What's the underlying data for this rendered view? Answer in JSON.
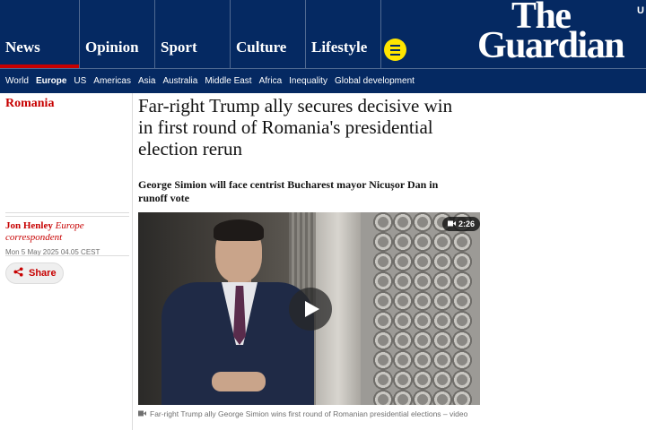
{
  "brand": {
    "line1": "The",
    "line2": "Guardian",
    "edition_partial": "U"
  },
  "pillars": [
    {
      "label": "News",
      "active": true
    },
    {
      "label": "Opinion",
      "active": false
    },
    {
      "label": "Sport",
      "active": false
    },
    {
      "label": "Culture",
      "active": false
    },
    {
      "label": "Lifestyle",
      "active": false
    }
  ],
  "menu_icon": "menu-icon",
  "subnav": [
    {
      "label": "World",
      "current": false
    },
    {
      "label": "Europe",
      "current": true
    },
    {
      "label": "US",
      "current": false
    },
    {
      "label": "Americas",
      "current": false
    },
    {
      "label": "Asia",
      "current": false
    },
    {
      "label": "Australia",
      "current": false
    },
    {
      "label": "Middle East",
      "current": false
    },
    {
      "label": "Africa",
      "current": false
    },
    {
      "label": "Inequality",
      "current": false
    },
    {
      "label": "Global development",
      "current": false
    }
  ],
  "article": {
    "section": "Romania",
    "headline": "Far-right Trump ally secures decisive win in first round of Romania's presidential election rerun",
    "standfirst": "George Simion will face centrist Bucharest mayor Nicușor Dan in runoff vote",
    "author_name": "Jon Henley",
    "author_role": "Europe correspondent",
    "date": "Mon 5 May 2025 04.05 CEST",
    "share_label": "Share"
  },
  "media": {
    "duration": "2:26",
    "caption": "Far-right Trump ally George Simion wins first round of Romanian presidential elections – video"
  },
  "colors": {
    "brand_blue": "#052962",
    "news_red": "#c70000",
    "menu_yellow": "#ffe500"
  }
}
